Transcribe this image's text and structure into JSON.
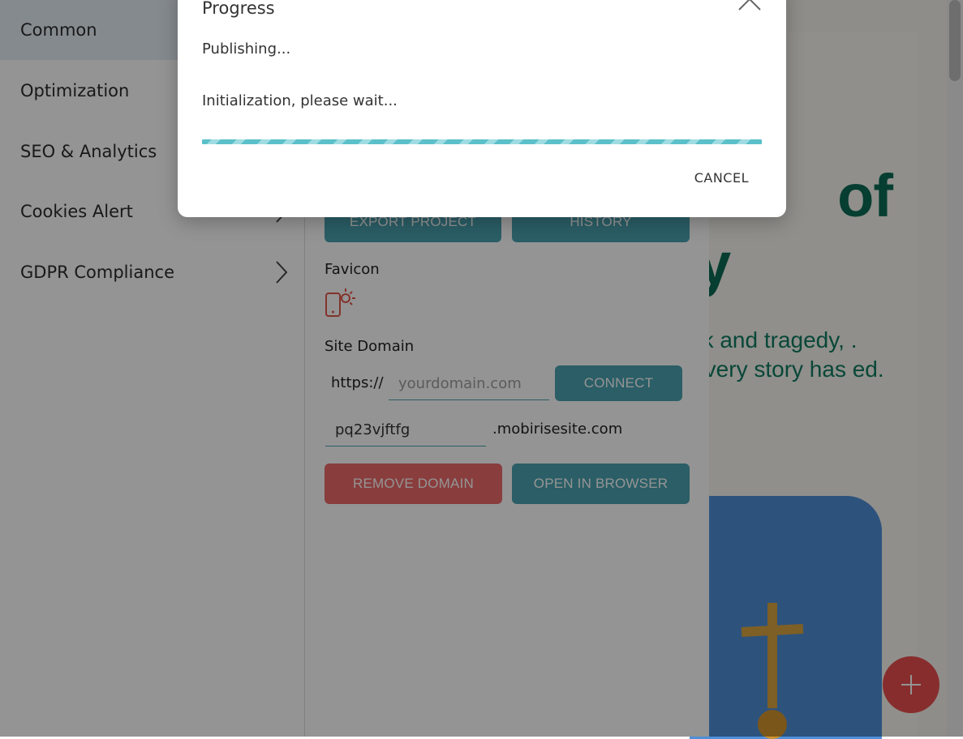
{
  "menu": {
    "items": [
      {
        "label": "Common",
        "active": true,
        "chevron": false
      },
      {
        "label": "Optimization",
        "active": false,
        "chevron": false
      },
      {
        "label": "SEO & Analytics",
        "active": false,
        "chevron": false
      },
      {
        "label": "Cookies Alert",
        "active": false,
        "chevron": true
      },
      {
        "label": "GDPR Compliance",
        "active": false,
        "chevron": true
      }
    ]
  },
  "panel": {
    "export_label": "EXPORT PROJECT",
    "history_label": "HISTORY",
    "favicon_label": "Favicon",
    "favicon_icon": "phone-sun-icon",
    "site_domain_label": "Site Domain",
    "protocol_prefix": "https://",
    "domain_placeholder": "yourdomain.com",
    "connect_label": "CONNECT",
    "subdomain_value": "pq23vjftfg",
    "subdomain_suffix": ".mobirisesite.com",
    "remove_domain_label": "REMOVE DOMAIN",
    "open_browser_label": "OPEN IN BROWSER"
  },
  "preview": {
    "hero_title_line1": "of",
    "hero_title_line2": "y",
    "hero_text": "ak and tragedy, . Every story has ed."
  },
  "dialog": {
    "title": "Progress",
    "status": "Publishing...",
    "detail": "Initialization, please wait...",
    "progress_state": "indeterminate",
    "cancel_label": "CANCEL"
  },
  "colors": {
    "accent": "#4ba3b0",
    "danger": "#ee6969",
    "hero_text": "#0b6b55",
    "fab": "#e94f4f",
    "progress": "#5bc0c9"
  }
}
